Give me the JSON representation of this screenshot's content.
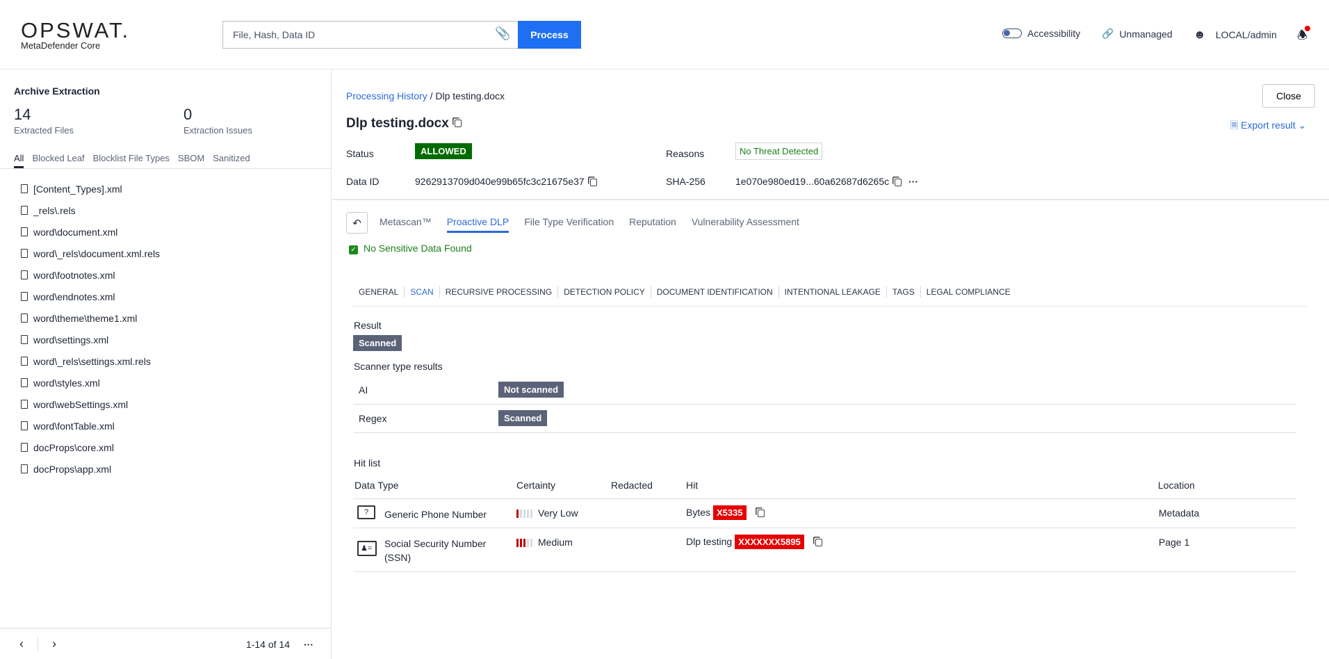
{
  "header": {
    "logo": "OPSWAT.",
    "product": "MetaDefender Core",
    "search_placeholder": "File, Hash, Data ID",
    "process": "Process",
    "accessibility": "Accessibility",
    "unmanaged": "Unmanaged",
    "user": "LOCAL/admin"
  },
  "sidebar": {
    "title": "Archive Extraction",
    "extracted_count": "14",
    "extracted_label": "Extracted Files",
    "issues_count": "0",
    "issues_label": "Extraction Issues",
    "tabs": [
      "All",
      "Blocked Leaf",
      "Blocklist File Types",
      "SBOM",
      "Sanitized"
    ],
    "files": [
      "[Content_Types].xml",
      "_rels\\.rels",
      "word\\document.xml",
      "word\\_rels\\document.xml.rels",
      "word\\footnotes.xml",
      "word\\endnotes.xml",
      "word\\theme\\theme1.xml",
      "word\\settings.xml",
      "word\\_rels\\settings.xml.rels",
      "word\\styles.xml",
      "word\\webSettings.xml",
      "word\\fontTable.xml",
      "docProps\\core.xml",
      "docProps\\app.xml"
    ],
    "pagination": "1-14 of 14"
  },
  "main": {
    "breadcrumb_link": "Processing History",
    "breadcrumb_current": "/ Dlp testing.docx",
    "close": "Close",
    "title": "Dlp testing.docx",
    "export": "Export result",
    "status_label": "Status",
    "status": "ALLOWED",
    "reasons_label": "Reasons",
    "reasons": "No Threat Detected",
    "dataid_label": "Data ID",
    "dataid": "9262913709d040e99b65fc3c21675e37",
    "sha_label": "SHA-256",
    "sha": "1e070e980ed19...60a62687d6265c",
    "tabs": [
      "Metascan™",
      "Proactive DLP",
      "File Type Verification",
      "Reputation",
      "Vulnerability Assessment"
    ],
    "dlp_status": "No Sensitive Data Found",
    "subtabs": [
      "GENERAL",
      "SCAN",
      "RECURSIVE PROCESSING",
      "DETECTION POLICY",
      "DOCUMENT IDENTIFICATION",
      "INTENTIONAL LEAKAGE",
      "TAGS",
      "LEGAL COMPLIANCE"
    ],
    "result_label": "Result",
    "result": "Scanned",
    "scanner_label": "Scanner type results",
    "scanners": [
      {
        "name": "AI",
        "status": "Not scanned"
      },
      {
        "name": "Regex",
        "status": "Scanned"
      }
    ],
    "hitlist_label": "Hit list",
    "hit_headers": [
      "Data Type",
      "Certainty",
      "Redacted",
      "Hit",
      "Location"
    ],
    "hits": [
      {
        "type": "Generic Phone Number",
        "certainty": "Very Low",
        "certainty_level": 1,
        "hit_prefix": "Bytes",
        "hit": "X5335",
        "location": "Metadata"
      },
      {
        "type": "Social Security Number (SSN)",
        "certainty": "Medium",
        "certainty_level": 3,
        "hit_prefix": "Dlp testing",
        "hit": "XXXXXXX5895",
        "location": "Page 1"
      }
    ]
  },
  "colors": {
    "accent": "#1e6ff1",
    "allowed": "#006b00",
    "hit": "#e60000",
    "badge": "#5b6379"
  }
}
